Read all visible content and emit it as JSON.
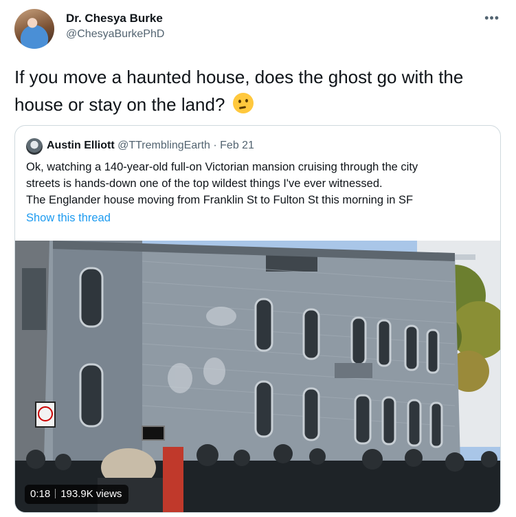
{
  "tweet": {
    "author_name": "Dr. Chesya Burke",
    "author_handle": "@ChesyaBurkePhD",
    "more_icon": "more-horizontal-icon",
    "text": "If you move a haunted house, does the ghost go with the house or stay on the land?",
    "emoji": "thinking-face"
  },
  "quoted_tweet": {
    "author_name": "Austin Elliott",
    "author_handle": "@TTremblingEarth",
    "separator": "·",
    "date": "Feb 21",
    "lines": [
      "Ok, watching a 140-year-old full-on Victorian mansion cruising through the city",
      "streets is hands-down one of the top wildest things I've ever witnessed.",
      "The Englander house moving from Franklin St to Fulton St this morning in SF"
    ],
    "show_thread_label": "Show this thread",
    "video": {
      "duration": "0:18",
      "views": "193.9K views"
    }
  },
  "colors": {
    "link": "#1d9bf0",
    "secondary_text": "#536471",
    "border": "#cfd9de"
  }
}
